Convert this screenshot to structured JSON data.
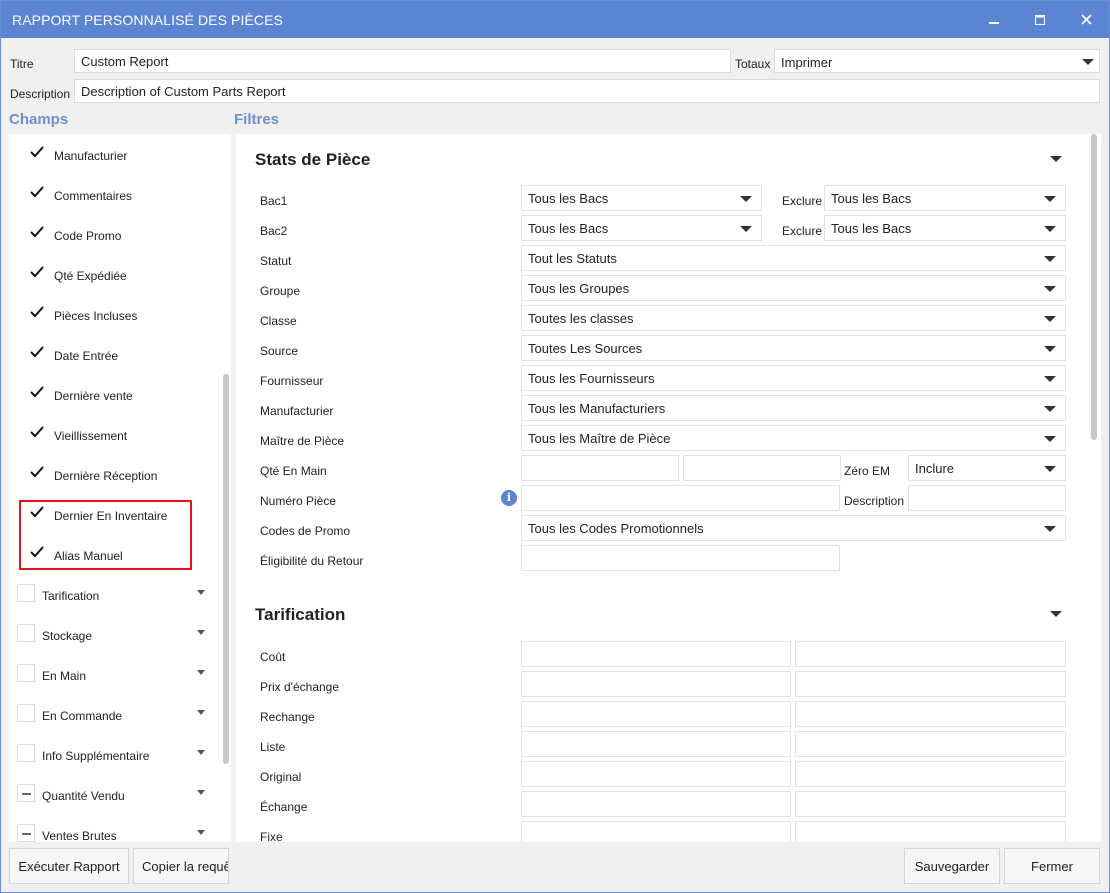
{
  "window": {
    "title": "RAPPORT PERSONNALISÉ DES PIÈCES"
  },
  "header": {
    "title_label": "Titre",
    "title_value": "Custom Report",
    "totals_label": "Totaux",
    "totals_value": "Imprimer",
    "description_label": "Description",
    "description_value": "Description of Custom Parts Report"
  },
  "sections": {
    "fields": "Champs",
    "filters": "Filtres"
  },
  "fields": {
    "items": [
      {
        "label": "Manufacturier",
        "state": "checked"
      },
      {
        "label": "Commentaires",
        "state": "checked"
      },
      {
        "label": "Code Promo",
        "state": "checked"
      },
      {
        "label": "Qté Expédiée",
        "state": "checked"
      },
      {
        "label": "Pièces Incluses",
        "state": "checked"
      },
      {
        "label": "Date Entrée",
        "state": "checked"
      },
      {
        "label": "Dernière vente",
        "state": "checked"
      },
      {
        "label": "Vieillissement",
        "state": "checked"
      },
      {
        "label": "Dernière Réception",
        "state": "checked"
      },
      {
        "label": "Dernier En Inventaire",
        "state": "checked"
      },
      {
        "label": "Alias Manuel",
        "state": "checked"
      }
    ],
    "groups": [
      {
        "label": "Tarification",
        "state": "unchecked"
      },
      {
        "label": "Stockage",
        "state": "unchecked"
      },
      {
        "label": "En Main",
        "state": "unchecked"
      },
      {
        "label": "En Commande",
        "state": "unchecked"
      },
      {
        "label": "Info Supplémentaire",
        "state": "unchecked"
      },
      {
        "label": "Quantité Vendu",
        "state": "partial"
      },
      {
        "label": "Ventes Brutes",
        "state": "partial"
      }
    ]
  },
  "filters": {
    "stats": {
      "title": "Stats de Pièce",
      "bac1_label": "Bac1",
      "bac1_value": "Tous les Bacs",
      "bac1_exclude_label": "Exclure",
      "bac1_exclude_value": "Tous les Bacs",
      "bac2_label": "Bac2",
      "bac2_value": "Tous les Bacs",
      "bac2_exclude_label": "Exclure",
      "bac2_exclude_value": "Tous les Bacs",
      "statut_label": "Statut",
      "statut_value": "Tout les Statuts",
      "groupe_label": "Groupe",
      "groupe_value": "Tous les Groupes",
      "classe_label": "Classe",
      "classe_value": "Toutes les classes",
      "source_label": "Source",
      "source_value": "Toutes Les Sources",
      "fournisseur_label": "Fournisseur",
      "fournisseur_value": "Tous les Fournisseurs",
      "manufacturier_label": "Manufacturier",
      "manufacturier_value": "Tous les Manufacturiers",
      "maitre_label": "Maître de Pièce",
      "maitre_value": "Tous les Maître de Pièce",
      "qte_label": "Qté En Main",
      "zero_label": "Zéro EM",
      "zero_value": "Inclure",
      "numero_label": "Numéro Pièce",
      "description_label": "Description",
      "promo_label": "Codes de Promo",
      "promo_value": "Tous les Codes Promotionnels",
      "retour_label": "Éligibilité du Retour",
      "info_icon": "i"
    },
    "pricing": {
      "title": "Tarification",
      "rows": [
        "Coût",
        "Prix d'échange",
        "Rechange",
        "Liste",
        "Original",
        "Échange",
        "Fixe"
      ]
    }
  },
  "buttons": {
    "run": "Exécuter Rapport",
    "copy": "Copier la requête",
    "save": "Sauvegarder",
    "close": "Fermer"
  }
}
